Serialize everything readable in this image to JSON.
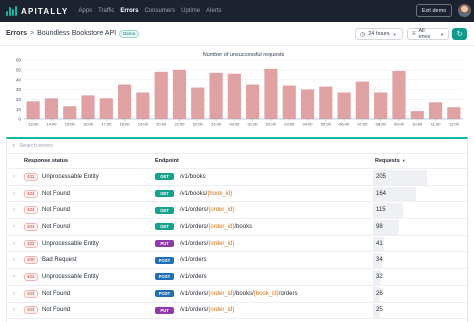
{
  "topnav": {
    "brand": "APITALLY",
    "items": [
      {
        "label": "Apps",
        "active": false
      },
      {
        "label": "Traffic",
        "active": false
      },
      {
        "label": "Errors",
        "active": true
      },
      {
        "label": "Consumers",
        "active": false
      },
      {
        "label": "Uptime",
        "active": false
      },
      {
        "label": "Alerts",
        "active": false
      }
    ],
    "exit_label": "Exit demo"
  },
  "header": {
    "root": "Errors",
    "separator": ">",
    "page": "Boundless Bookstore API",
    "badge": "Demo",
    "period": "24 hours",
    "envs": "All envs"
  },
  "chart_data": {
    "type": "bar",
    "title": "Number of unsuccessful requests",
    "categories": [
      "13:00",
      "14:00",
      "15:00",
      "16:00",
      "17:00",
      "18:00",
      "19:00",
      "20:00",
      "21:00",
      "22:00",
      "23:00",
      "00:00",
      "01:00",
      "02:00",
      "03:00",
      "04:00",
      "05:00",
      "06:00",
      "07:00",
      "08:00",
      "09:00",
      "10:00",
      "11:00",
      "12:00"
    ],
    "values": [
      18,
      21,
      13,
      24,
      21,
      35,
      27,
      48,
      50,
      32,
      47,
      46,
      35,
      51,
      34,
      30,
      33,
      27,
      38,
      27,
      49,
      8,
      17,
      12
    ],
    "ylim": [
      0,
      60
    ],
    "yticks": [
      0,
      10,
      20,
      30,
      40,
      50,
      60
    ],
    "bar_color": "#e0a1a3",
    "grid": true
  },
  "table": {
    "search_placeholder": "Search errors",
    "columns": {
      "status": "Response status",
      "endpoint": "Endpoint",
      "requests": "Requests"
    },
    "sort_indicator": "▼",
    "max_requests": 205,
    "rows": [
      {
        "code": "422",
        "status": "Unprocessable Entity",
        "method": "GET",
        "path": [
          {
            "t": "/v1/books"
          }
        ],
        "requests": 205
      },
      {
        "code": "404",
        "status": "Not Found",
        "method": "GET",
        "path": [
          {
            "t": "/v1/books/"
          },
          {
            "t": "{book_id}",
            "p": true
          }
        ],
        "requests": 164
      },
      {
        "code": "404",
        "status": "Not Found",
        "method": "GET",
        "path": [
          {
            "t": "/v1/orders/"
          },
          {
            "t": "{order_id}",
            "p": true
          }
        ],
        "requests": 115
      },
      {
        "code": "404",
        "status": "Not Found",
        "method": "GET",
        "path": [
          {
            "t": "/v1/orders/"
          },
          {
            "t": "{order_id}",
            "p": true
          },
          {
            "t": "/books"
          }
        ],
        "requests": 98
      },
      {
        "code": "422",
        "status": "Unprocessable Entity",
        "method": "PUT",
        "path": [
          {
            "t": "/v1/orders/"
          },
          {
            "t": "{order_id}",
            "p": true
          }
        ],
        "requests": 41
      },
      {
        "code": "400",
        "status": "Bad Request",
        "method": "POST",
        "path": [
          {
            "t": "/v1/orders"
          }
        ],
        "requests": 34
      },
      {
        "code": "422",
        "status": "Unprocessable Entity",
        "method": "POST",
        "path": [
          {
            "t": "/v1/orders"
          }
        ],
        "requests": 32
      },
      {
        "code": "404",
        "status": "Not Found",
        "method": "POST",
        "path": [
          {
            "t": "/v1/orders/"
          },
          {
            "t": "{order_id}",
            "p": true
          },
          {
            "t": "/books/"
          },
          {
            "t": "{book_id}",
            "p": true
          },
          {
            "t": "/orders"
          }
        ],
        "requests": 26
      },
      {
        "code": "404",
        "status": "Not Found",
        "method": "PUT",
        "path": [
          {
            "t": "/v1/orders/"
          },
          {
            "t": "{order_id}",
            "p": true
          }
        ],
        "requests": 25
      }
    ]
  },
  "colors": {
    "nav_bg": "#1c2230",
    "accent": "#14b8a6",
    "method_get": "#14a38f",
    "method_put": "#8e3aa8",
    "method_post": "#1f6fb5",
    "error_code": "#d92d20",
    "param": "#d9731a"
  }
}
